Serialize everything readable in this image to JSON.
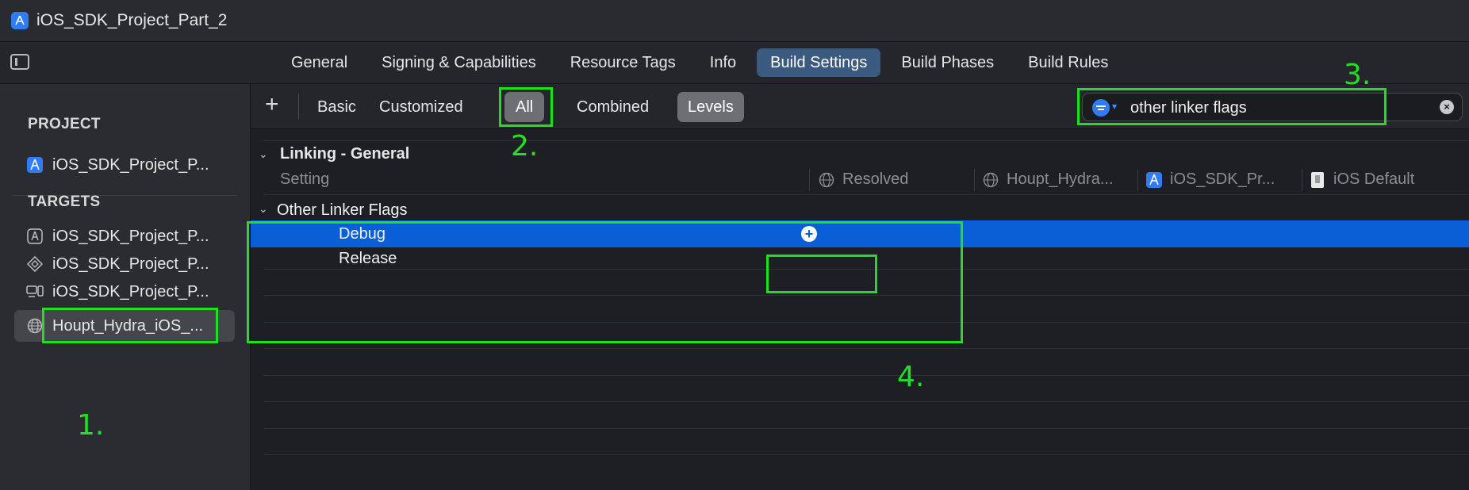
{
  "window": {
    "title": "iOS_SDK_Project_Part_2"
  },
  "tabs": [
    {
      "label": "General",
      "active": false
    },
    {
      "label": "Signing & Capabilities",
      "active": false
    },
    {
      "label": "Resource Tags",
      "active": false
    },
    {
      "label": "Info",
      "active": false
    },
    {
      "label": "Build Settings",
      "active": true
    },
    {
      "label": "Build Phases",
      "active": false
    },
    {
      "label": "Build Rules",
      "active": false
    }
  ],
  "sidebar": {
    "project_header": "PROJECT",
    "project_item": "iOS_SDK_Project_P...",
    "targets_header": "TARGETS",
    "targets": [
      {
        "label": "iOS_SDK_Project_P...",
        "icon": "app-target-icon"
      },
      {
        "label": "iOS_SDK_Project_P...",
        "icon": "test-target-icon"
      },
      {
        "label": "iOS_SDK_Project_P...",
        "icon": "ui-test-target-icon"
      },
      {
        "label": "Houpt_Hydra_iOS_...",
        "icon": "globe-icon",
        "selected": true
      }
    ]
  },
  "filterbar": {
    "add": "+",
    "segments": [
      "Basic",
      "Customized",
      "All",
      "Combined",
      "Levels"
    ],
    "active_segments": [
      "All",
      "Levels"
    ],
    "search_value": "other linker flags",
    "clear": "×"
  },
  "main": {
    "group_title": "Linking - General",
    "columns": {
      "setting": "Setting",
      "resolved": "Resolved",
      "target": "Houpt_Hydra...",
      "project": "iOS_SDK_Pr...",
      "default": "iOS Default"
    },
    "setting_name": "Other Linker Flags",
    "rows": [
      "Debug",
      "Release"
    ],
    "add_value": "+"
  },
  "annotations": {
    "one": "1.",
    "two": "2.",
    "three": "3.",
    "four": "4."
  },
  "colors": {
    "accent": "#0a5fd6",
    "highlight": "#1fe01f",
    "active_tab": "#3a5a80"
  }
}
